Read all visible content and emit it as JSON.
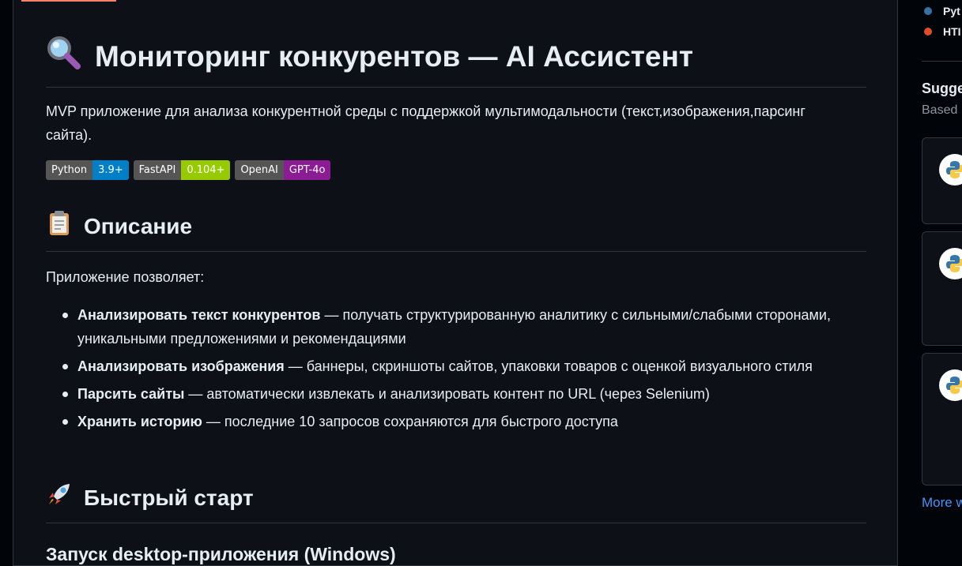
{
  "readme": {
    "title": "Мониторинг конкурентов — AI Ассистент",
    "title_icon": "magnifier-icon",
    "description": "MVP приложение для анализа конкурентной среды с поддержкой мультимодальности (текст,изображения,парсинг сайта).",
    "badges": [
      {
        "label": "Python",
        "value": "3.9+",
        "color": "#007ec6"
      },
      {
        "label": "FastAPI",
        "value": "0.104+",
        "color": "#97ca00"
      },
      {
        "label": "OpenAI",
        "value": "GPT-4o",
        "color": "#8b1c94"
      }
    ],
    "section_description": {
      "icon": "clipboard-icon",
      "heading": "Описание"
    },
    "intro": "Приложение позволяет:",
    "features": [
      {
        "bold": "Анализировать текст конкурентов",
        "rest": " — получать структурированную аналитику с сильными/слабыми сторонами, уникальными предложениями и рекомендациями"
      },
      {
        "bold": "Анализировать изображения",
        "rest": " — баннеры, скриншоты сайтов, упаковки товаров с оценкой визуального стиля"
      },
      {
        "bold": "Парсить сайты",
        "rest": " — автоматически извлекать и анализировать контент по URL (через Selenium)"
      },
      {
        "bold": "Хранить историю",
        "rest": " — последние 10 запросов сохраняются для быстрого доступа"
      }
    ],
    "section_quickstart": {
      "icon": "rocket-icon",
      "heading": "Быстрый старт"
    },
    "subheading": "Запуск desktop-приложения (Windows)"
  },
  "sidebar": {
    "languages": [
      {
        "label": "Pyt",
        "color": "#3572A5"
      },
      {
        "label": "HTI",
        "color": "#e34c26"
      }
    ],
    "suggested_title": "Sugge",
    "suggested_sub": "Based",
    "cards": [
      {
        "icon": "python-icon"
      },
      {
        "icon": "python-icon"
      },
      {
        "icon": "python-icon"
      }
    ],
    "more_link": "More w"
  }
}
